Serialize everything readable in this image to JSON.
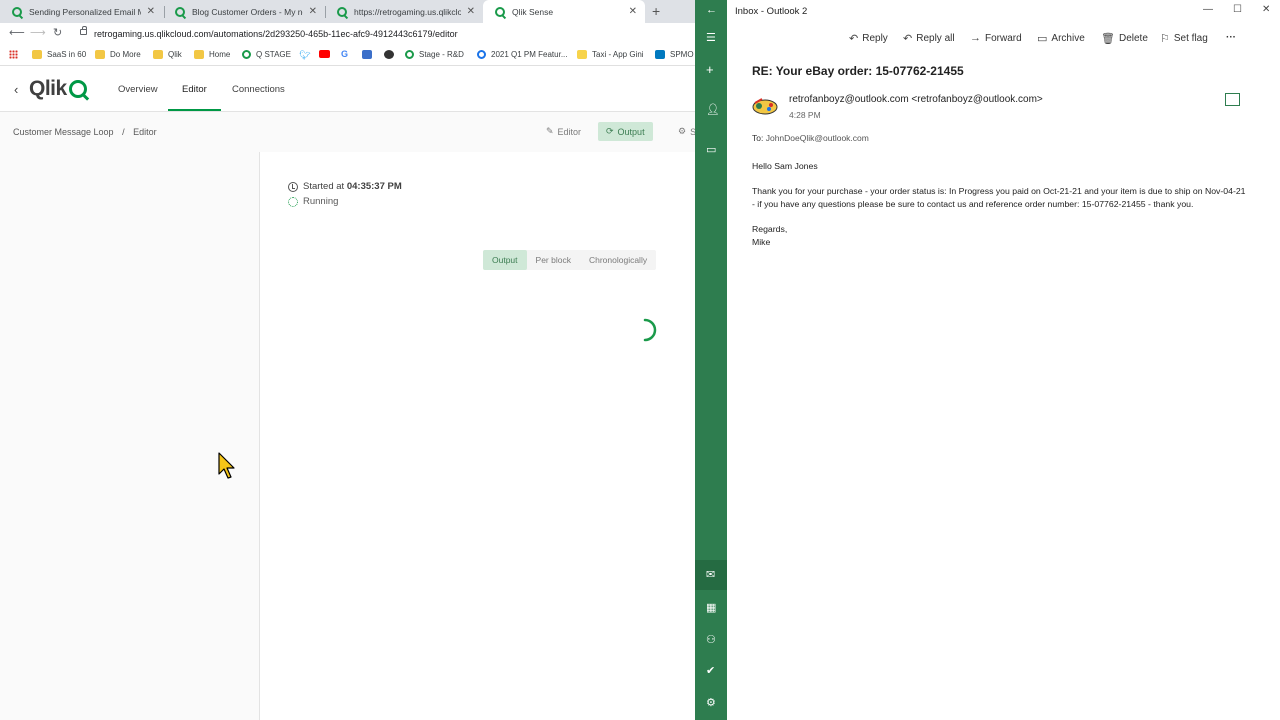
{
  "browser": {
    "tabs": [
      {
        "title": "Sending Personalized Email Mess",
        "active": false
      },
      {
        "title": "Blog Customer Orders - My new",
        "active": false
      },
      {
        "title": "https://retrogaming.us.qlikcloud.",
        "active": false
      },
      {
        "title": "Qlik Sense",
        "active": true
      }
    ],
    "close_glyph": "✕",
    "new_tab_glyph": "+",
    "url": "retrogaming.us.qlikcloud.com/automations/2d293250-465b-11ec-afc9-4912443c6179/editor",
    "bookmarks": [
      {
        "label": "SaaS in 60",
        "icon": "folder-icon"
      },
      {
        "label": "Do More",
        "icon": "folder-icon"
      },
      {
        "label": "Qlik",
        "icon": "folder-icon"
      },
      {
        "label": "Home",
        "icon": "folder-icon"
      },
      {
        "label": "Q STAGE",
        "icon": "qlik-icon"
      },
      {
        "label": "",
        "icon": "twitter-icon"
      },
      {
        "label": "",
        "icon": "youtube-icon"
      },
      {
        "label": "",
        "icon": "google-icon"
      },
      {
        "label": "",
        "icon": "calendar-icon"
      },
      {
        "label": "",
        "icon": "globe-icon"
      },
      {
        "label": "Stage - R&D",
        "icon": "qlik-icon"
      },
      {
        "label": "2021 Q1 PM Featur...",
        "icon": "circle-icon"
      },
      {
        "label": "Taxi - App Gini",
        "icon": "taxi-icon"
      },
      {
        "label": "SPMO",
        "icon": "trello-icon"
      }
    ]
  },
  "qlik": {
    "logo_text": "Qlik",
    "nav": [
      {
        "label": "Overview"
      },
      {
        "label": "Editor"
      },
      {
        "label": "Connections"
      }
    ],
    "breadcrumb": {
      "root": "Customer Message Loop",
      "sep": "/",
      "current": "Editor"
    },
    "modes": [
      {
        "label": "Editor"
      },
      {
        "label": "Output"
      },
      {
        "label": "S"
      }
    ],
    "run": {
      "started_prefix": "Started at",
      "started_time": "04:35:37 PM",
      "status": "Running"
    },
    "output_tabs": [
      {
        "label": "Output"
      },
      {
        "label": "Per block"
      },
      {
        "label": "Chronologically"
      }
    ]
  },
  "outlook": {
    "window_title": "Inbox - Outlook 2",
    "toolbar": [
      {
        "label": "Reply",
        "icon": "reply-icon"
      },
      {
        "label": "Reply all",
        "icon": "reply-all-icon"
      },
      {
        "label": "Forward",
        "icon": "forward-icon"
      },
      {
        "label": "Archive",
        "icon": "archive-icon"
      },
      {
        "label": "Delete",
        "icon": "trash-icon"
      },
      {
        "label": "Set flag",
        "icon": "flag-icon"
      },
      {
        "label": "···",
        "icon": "more-icon"
      }
    ],
    "subject": "RE: Your eBay order: 15-07762-21455",
    "sender": "retrofanboyz@outlook.com <retrofanboyz@outlook.com>",
    "time": "4:28 PM",
    "to_label": "To:",
    "to_address": "JohnDoeQlik@outlook.com",
    "body": {
      "greeting": "Hello Sam Jones",
      "line1": "Thank you for your purchase - your order status is: In Progress you paid on Oct-21-21 and your item is due to ship on Nov-04-21",
      "line2": "- if you have any questions please be sure to contact us and reference order number: 15-07762-21455 - thank you.",
      "regards": "Regards,",
      "signature": "Mike"
    }
  }
}
